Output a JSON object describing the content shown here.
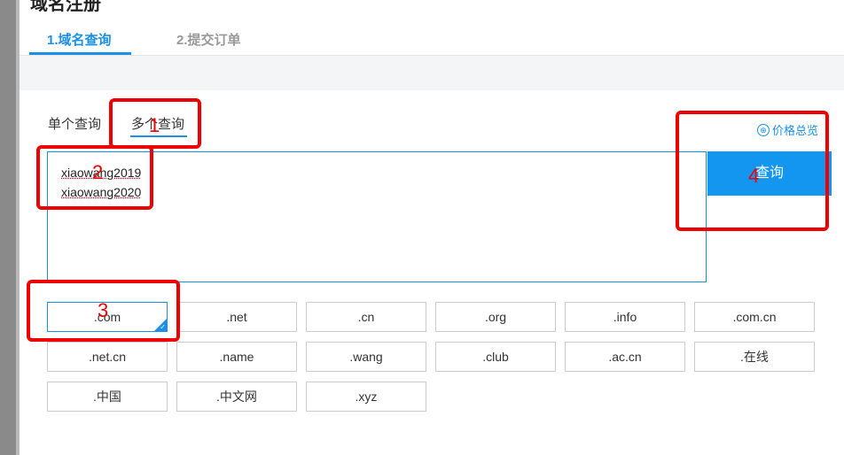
{
  "header": {
    "title_fragment": "域名注册",
    "steps": [
      "1.域名查询",
      "2.提交订单"
    ]
  },
  "query_modes": {
    "single": "单个查询",
    "multi": "多个查询"
  },
  "price_link": "价格总览",
  "textarea": {
    "lines": [
      "xiaowang2019",
      "xiaowang2020"
    ]
  },
  "query_button": "查询",
  "tlds": [
    ".com",
    ".net",
    ".cn",
    ".org",
    ".info",
    ".com.cn",
    ".net.cn",
    ".name",
    ".wang",
    ".club",
    ".ac.cn",
    ".在线",
    ".中国",
    ".中文网",
    ".xyz"
  ],
  "selected_tld": ".com",
  "annotations": [
    "1",
    "2",
    "3",
    "4"
  ],
  "colors": {
    "accent": "#1a90e8",
    "annotation": "#e00000"
  }
}
